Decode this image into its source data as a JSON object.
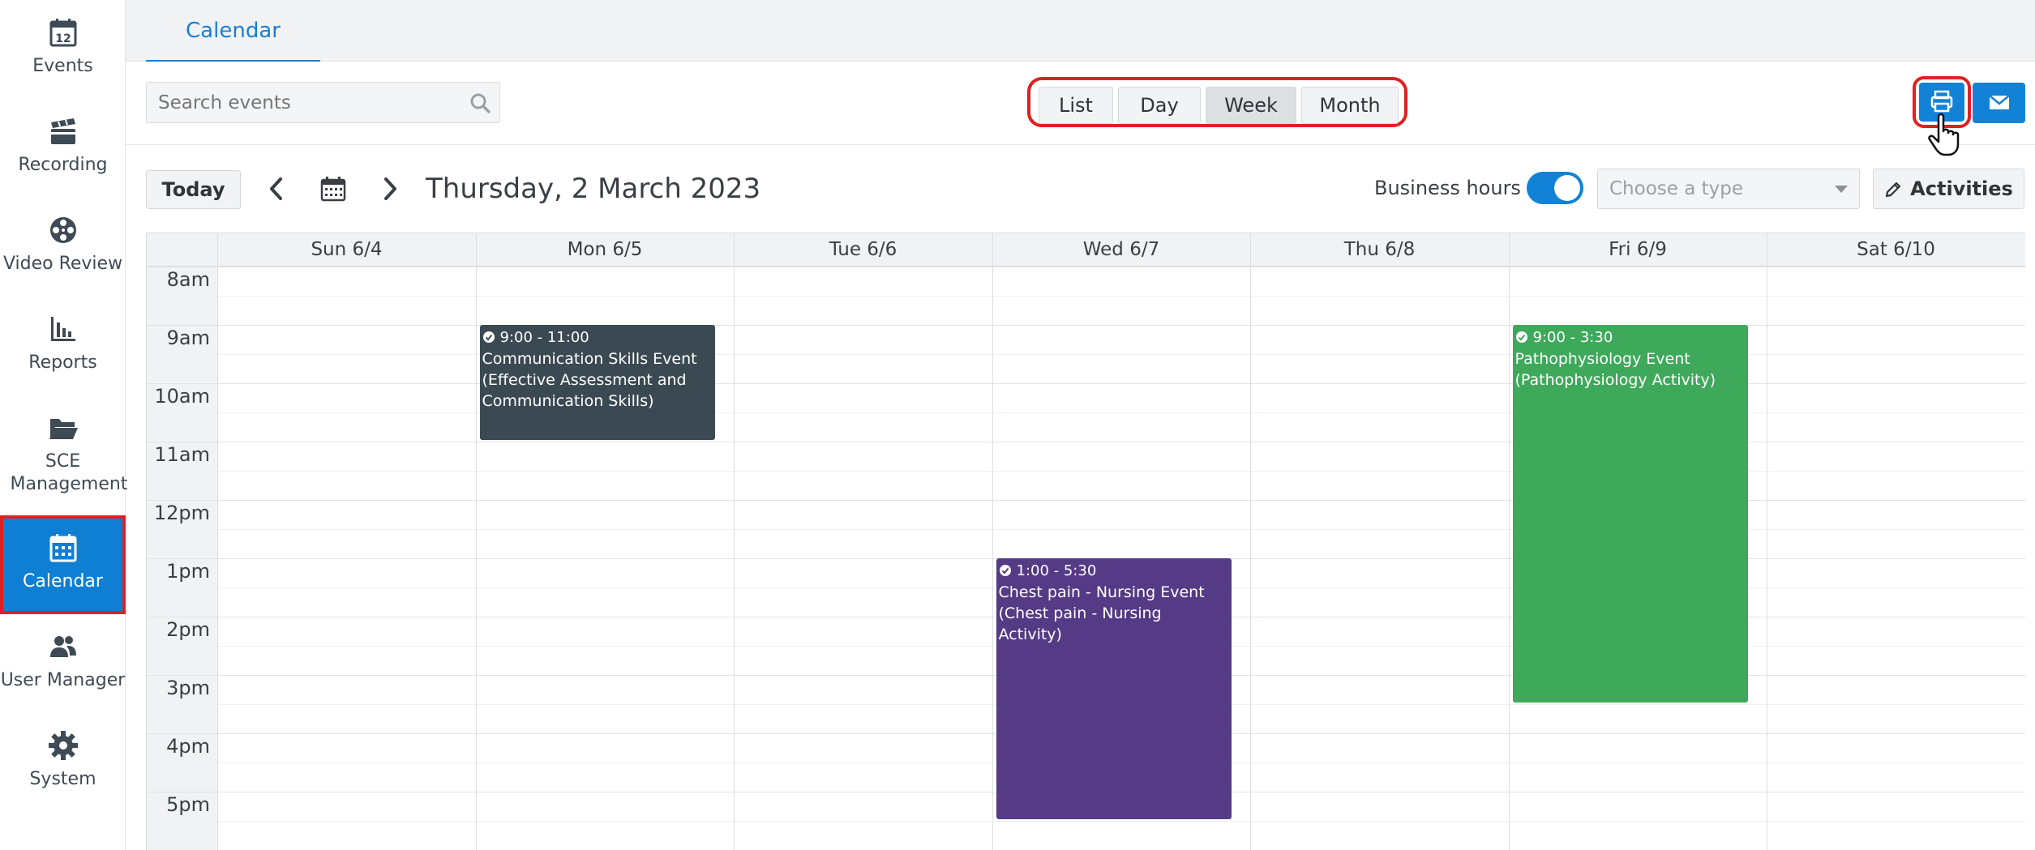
{
  "sidebar": {
    "items": [
      {
        "label": "Events",
        "icon": "calendar-12-icon"
      },
      {
        "label": "Recording",
        "icon": "clapperboard-icon"
      },
      {
        "label": "Video Review",
        "icon": "film-reel-icon"
      },
      {
        "label": "Reports",
        "icon": "bar-chart-icon"
      },
      {
        "label": "SCE Management",
        "icon": "folder-open-icon"
      },
      {
        "label": "Calendar",
        "icon": "calendar-icon",
        "active": true
      },
      {
        "label": "User Manager",
        "icon": "users-icon"
      },
      {
        "label": "System",
        "icon": "gear-icon"
      }
    ]
  },
  "tabs": {
    "active": "Calendar"
  },
  "search": {
    "placeholder": "Search events"
  },
  "views": {
    "list": "List",
    "day": "Day",
    "week": "Week",
    "month": "Month",
    "active": "Week"
  },
  "nav": {
    "today": "Today",
    "date_title": "Thursday, 2 March 2023"
  },
  "filters": {
    "business_hours_label": "Business hours",
    "business_hours_on": true,
    "type_placeholder": "Choose a type",
    "activities_label": "Activities"
  },
  "calendar": {
    "days": [
      "Sun 6/4",
      "Mon 6/5",
      "Tue 6/6",
      "Wed 6/7",
      "Thu 6/8",
      "Fri 6/9",
      "Sat 6/10"
    ],
    "hours": [
      "8am",
      "9am",
      "10am",
      "11am",
      "12pm",
      "1pm",
      "2pm",
      "3pm",
      "4pm",
      "5pm"
    ],
    "events": [
      {
        "time": "9:00 - 11:00",
        "title": "Communication Skills Event (Effective Assessment and Communication Skills)",
        "day": "Mon 6/5",
        "color": "#3b4952"
      },
      {
        "time": "1:00 - 5:30",
        "title": "Chest pain - Nursing Event (Chest pain - Nursing Activity)",
        "day": "Wed 6/7",
        "color": "#553a85"
      },
      {
        "time": "9:00 - 3:30",
        "title": "Pathophysiology Event (Pathophysiology Activity)",
        "day": "Fri 6/9",
        "color": "#3fa95b"
      }
    ]
  },
  "colors": {
    "accent": "#1282d6",
    "highlight": "#e02020"
  }
}
